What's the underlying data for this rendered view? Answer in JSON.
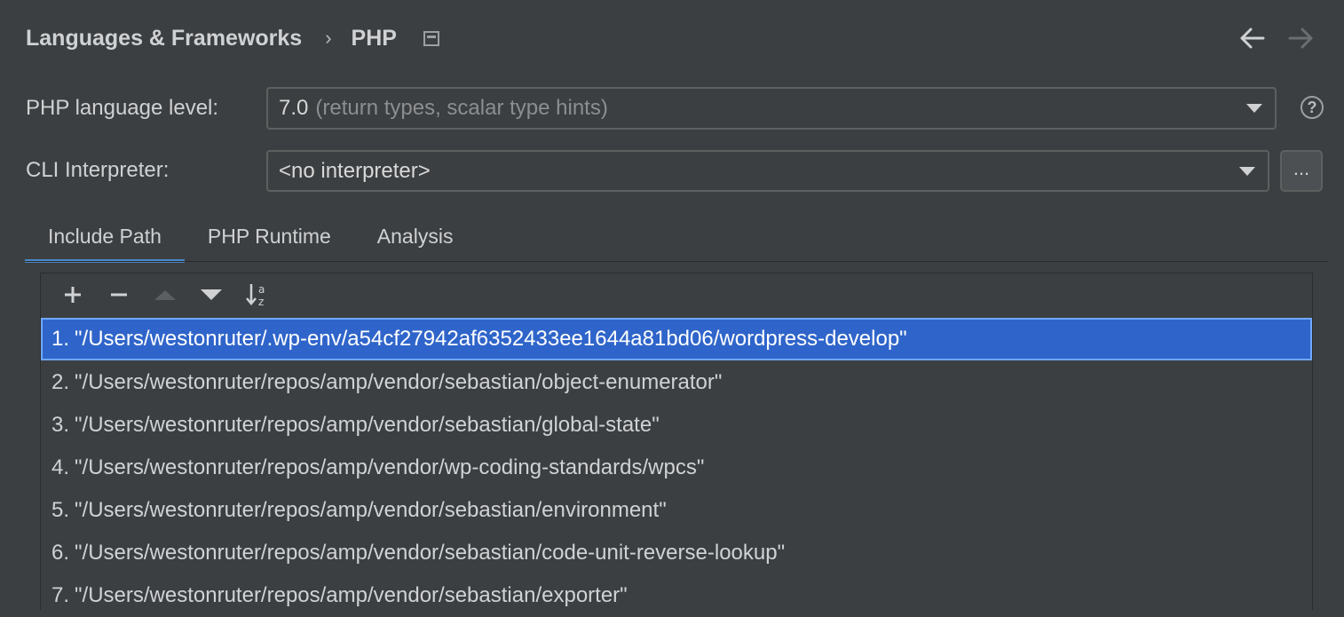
{
  "header": {
    "breadcrumb": [
      "Languages & Frameworks",
      "PHP"
    ],
    "separator": "›"
  },
  "form": {
    "language_level_label": "PHP language level:",
    "language_level_value": "7.0",
    "language_level_hint": "(return types, scalar type hints)",
    "cli_label": "CLI Interpreter:",
    "cli_value": "<no interpreter>",
    "more_button_label": "..."
  },
  "tabs": [
    {
      "label": "Include Path",
      "active": true
    },
    {
      "label": "PHP Runtime",
      "active": false
    },
    {
      "label": "Analysis",
      "active": false
    }
  ],
  "include_paths": [
    {
      "num": "1.",
      "path": "\"/Users/westonruter/.wp-env/a54cf27942af6352433ee1644a81bd06/wordpress-develop\"",
      "selected": true
    },
    {
      "num": "2.",
      "path": "\"/Users/westonruter/repos/amp/vendor/sebastian/object-enumerator\"",
      "selected": false
    },
    {
      "num": "3.",
      "path": "\"/Users/westonruter/repos/amp/vendor/sebastian/global-state\"",
      "selected": false
    },
    {
      "num": "4.",
      "path": "\"/Users/westonruter/repos/amp/vendor/wp-coding-standards/wpcs\"",
      "selected": false
    },
    {
      "num": "5.",
      "path": "\"/Users/westonruter/repos/amp/vendor/sebastian/environment\"",
      "selected": false
    },
    {
      "num": "6.",
      "path": "\"/Users/westonruter/repos/amp/vendor/sebastian/code-unit-reverse-lookup\"",
      "selected": false
    },
    {
      "num": "7.",
      "path": "\"/Users/westonruter/repos/amp/vendor/sebastian/exporter\"",
      "selected": false
    }
  ],
  "colors": {
    "background": "#3c3f41",
    "selection": "#2f65ca",
    "accent": "#4a88c7"
  }
}
